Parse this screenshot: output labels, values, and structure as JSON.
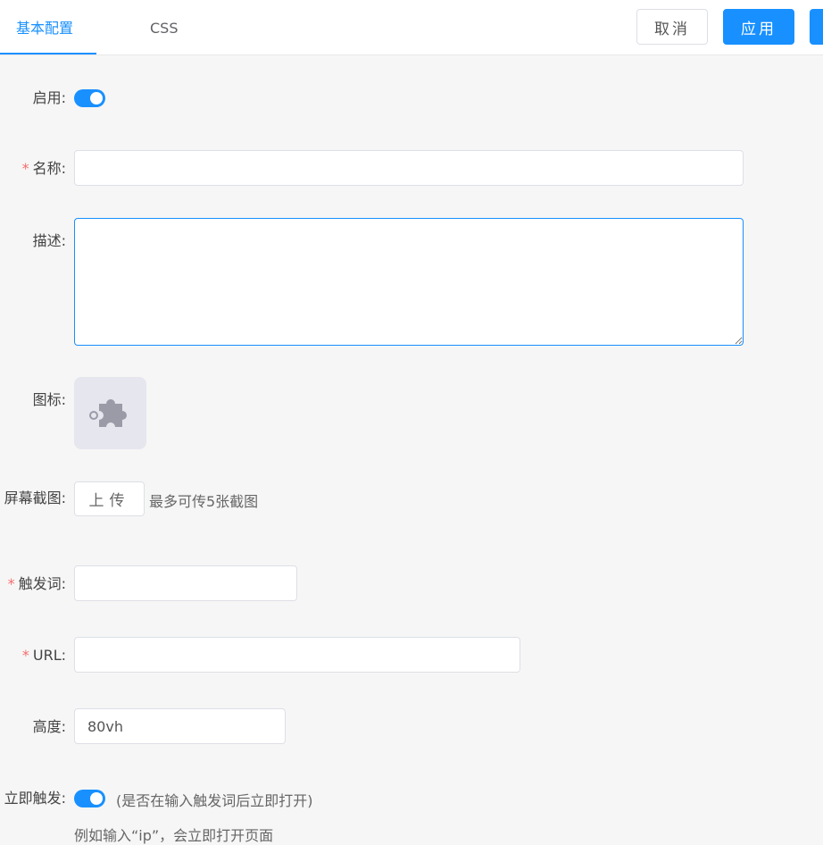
{
  "tabs": [
    {
      "label": "基本配置",
      "active": true
    },
    {
      "label": "CSS",
      "active": false
    }
  ],
  "actions": {
    "cancel": "取消",
    "apply": "应用"
  },
  "form": {
    "enabled": {
      "label": "启用:",
      "value": true
    },
    "name": {
      "label": "名称:",
      "required": true,
      "value": ""
    },
    "description": {
      "label": "描述:",
      "value": ""
    },
    "icon": {
      "label": "图标:",
      "icon": "puzzle-piece-icon"
    },
    "screenshots": {
      "label": "屏幕截图:",
      "upload": "上传",
      "hint": "最多可传5张截图"
    },
    "trigger": {
      "label": "触发词:",
      "required": true,
      "value": ""
    },
    "url": {
      "label": "URL:",
      "required": true,
      "value": ""
    },
    "height": {
      "label": "高度:",
      "value": "80vh"
    },
    "instant": {
      "label": "立即触发:",
      "value": true,
      "hint": "(是否在输入触发词后立即打开)",
      "example": "例如输入“ip”，会立即打开页面"
    }
  },
  "colors": {
    "accent": "#1890ff",
    "required": "#f56c6c",
    "background": "#f6f6f6"
  }
}
